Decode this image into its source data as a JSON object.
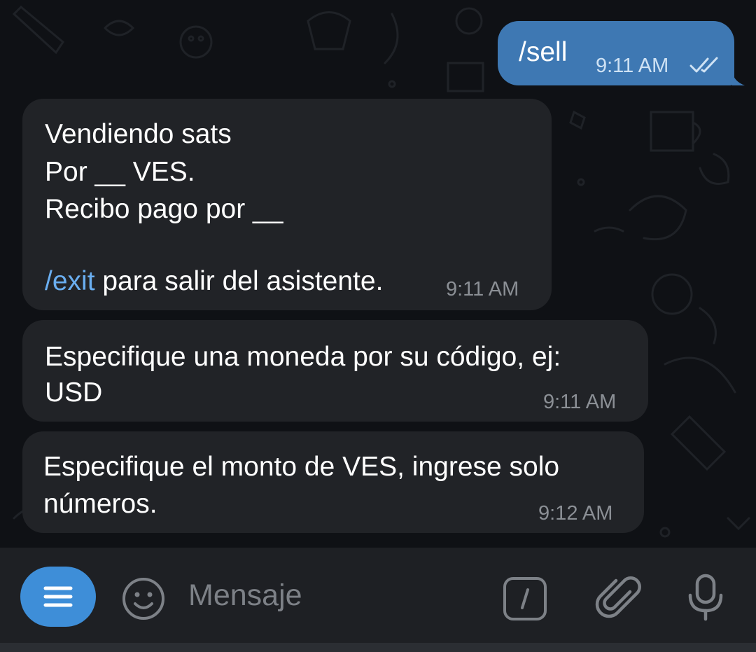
{
  "chat": {
    "messages": [
      {
        "direction": "outgoing",
        "text": "/sell",
        "time": "9:11 AM",
        "status": "read-double-check"
      },
      {
        "direction": "incoming",
        "lines": [
          "Vendiendo sats",
          "Por __ VES.",
          "Recibo pago por __"
        ],
        "command": "/exit",
        "after_command": " para salir del asistente.",
        "time": "9:11 AM"
      },
      {
        "direction": "incoming",
        "lines": [
          "Especifique una moneda por su código, ej:",
          "USD"
        ],
        "time": "9:11 AM"
      },
      {
        "direction": "incoming",
        "lines": [
          "Especifique el monto de VES, ingrese solo",
          "números."
        ],
        "time": "9:12 AM"
      }
    ]
  },
  "composer": {
    "placeholder": "Mensaje",
    "icons": [
      "menu-icon",
      "emoji-icon",
      "slash-command-icon",
      "paperclip-icon",
      "microphone-icon"
    ]
  },
  "colors": {
    "background": "#0f1115",
    "incoming_bubble": "#212327",
    "outgoing_bubble": "#3e78b3",
    "command_link": "#6aaef0",
    "menu_button": "#3e8ed8"
  }
}
